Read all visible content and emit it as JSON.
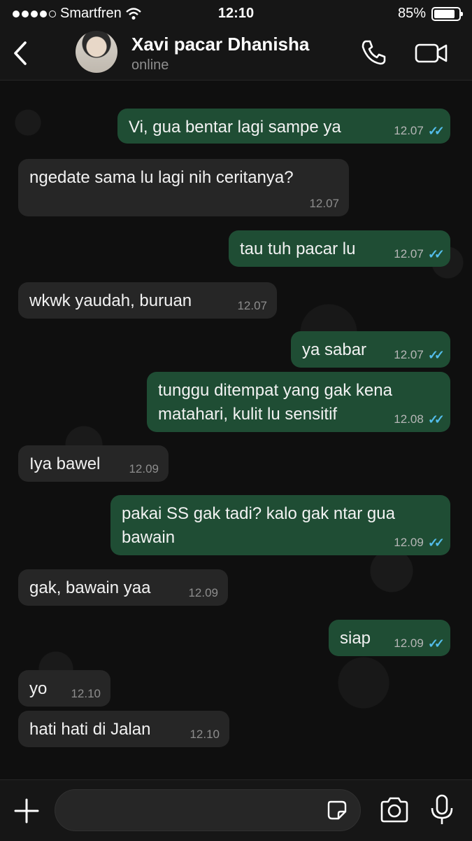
{
  "status_bar": {
    "carrier": "Smartfren",
    "time": "12:10",
    "battery": "85%",
    "battery_level": 0.85
  },
  "header": {
    "contact_name": "Xavi pacar Dhanisha",
    "contact_status": "online"
  },
  "messages": [
    {
      "dir": "out",
      "text": "Vi, gua bentar lagi sampe ya",
      "time": "12.07",
      "read": true
    },
    {
      "dir": "in",
      "text": "ngedate sama lu lagi nih ceritanya?",
      "time": "12.07"
    },
    {
      "dir": "out",
      "text": "tau tuh pacar lu",
      "time": "12.07",
      "read": true
    },
    {
      "dir": "in",
      "text": "wkwk yaudah, buruan",
      "time": "12.07"
    },
    {
      "dir": "out",
      "text": "ya sabar",
      "time": "12.07",
      "read": true
    },
    {
      "dir": "out",
      "text": "tunggu ditempat yang gak kena matahari, kulit lu sensitif",
      "time": "12.08",
      "read": true
    },
    {
      "dir": "in",
      "text": "Iya bawel",
      "time": "12.09"
    },
    {
      "dir": "out",
      "text": "pakai SS gak tadi? kalo gak ntar gua bawain",
      "time": "12.09",
      "read": true
    },
    {
      "dir": "in",
      "text": "gak, bawain yaa",
      "time": "12.09"
    },
    {
      "dir": "out",
      "text": "siap",
      "time": "12.09",
      "read": true
    },
    {
      "dir": "in",
      "text": "yo",
      "time": "12.10"
    },
    {
      "dir": "in",
      "text": "hati hati di Jalan",
      "time": "12.10"
    }
  ],
  "colors": {
    "outgoing_bubble": "#1f4d34",
    "incoming_bubble": "#262626",
    "read_tick": "#53bdeb"
  },
  "icons": {
    "back": "chevron-left-icon",
    "call": "phone-icon",
    "video": "video-camera-icon",
    "attach": "plus-icon",
    "sticker": "sticker-icon",
    "camera": "camera-icon",
    "mic": "microphone-icon"
  }
}
